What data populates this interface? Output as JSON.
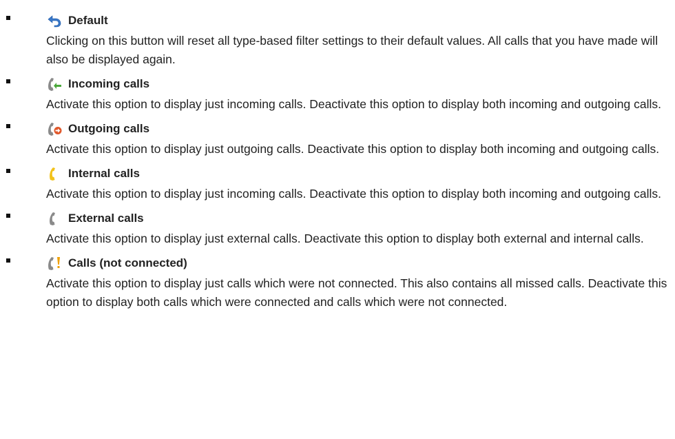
{
  "options": [
    {
      "icon": "reset-arrow-icon",
      "title": "Default",
      "description": "Clicking on this button will reset all type-based filter settings to their default values. All calls that you have made will also be displayed again."
    },
    {
      "icon": "incoming-call-icon",
      "title": "Incoming calls",
      "description": "Activate this option to display just incoming calls. Deactivate this option to display both incoming and outgoing calls."
    },
    {
      "icon": "outgoing-call-icon",
      "title": "Outgoing calls",
      "description": "Activate this option to display just outgoing calls. Deactivate this option to display both incoming and outgoing calls."
    },
    {
      "icon": "internal-call-icon",
      "title": "Internal calls",
      "description": "Activate this option to display just incoming calls. Deactivate this option to display both incoming and outgoing calls."
    },
    {
      "icon": "external-call-icon",
      "title": "External calls",
      "description": "Activate this option to display just external calls. Deactivate this option to display both external and internal calls."
    },
    {
      "icon": "not-connected-call-icon",
      "title": "Calls (not connected)",
      "description": "Activate this option to display just calls which were not connected. This also contains all missed calls. Deactivate this option to display both calls which were connected and calls which were not connected."
    }
  ],
  "colors": {
    "text": "#222222",
    "reset_arrow": "#3a78c8",
    "handset_grey": "#8a8a8a",
    "incoming_arrow": "#4aa83a",
    "outgoing_arrow": "#e0572a",
    "internal_yellow": "#f2c21b",
    "warning_orange": "#f0a000"
  }
}
